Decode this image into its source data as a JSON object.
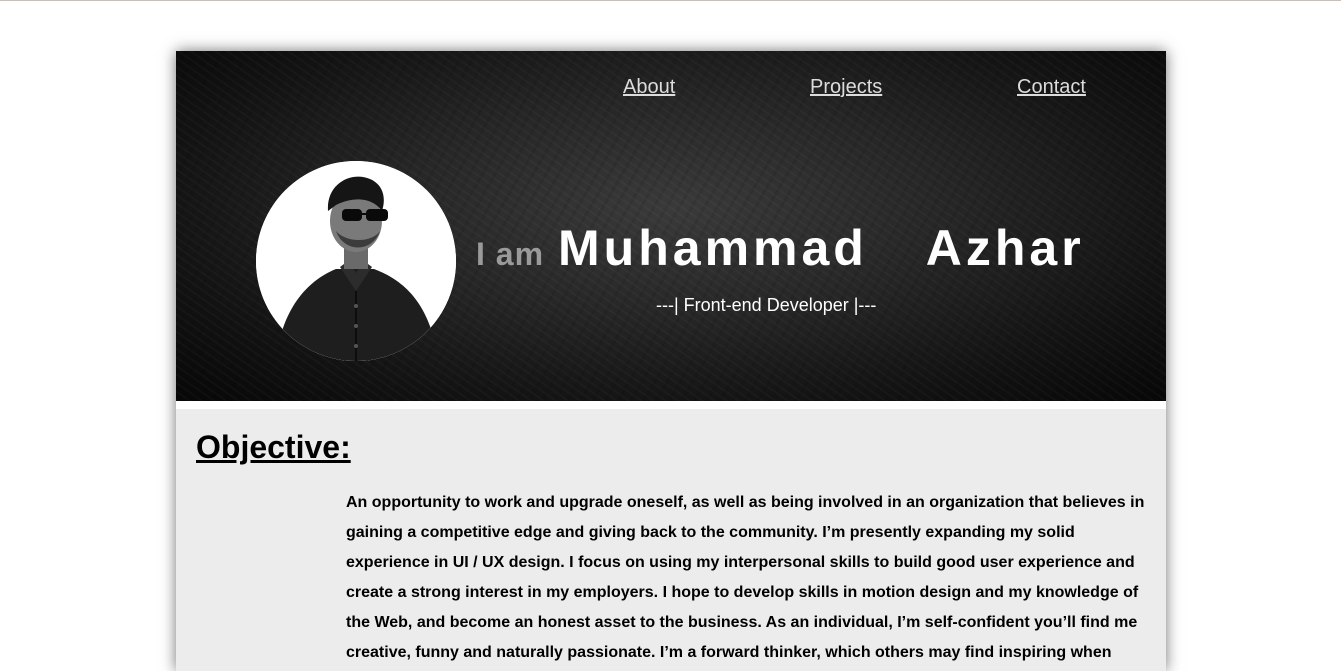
{
  "nav": {
    "about": "About",
    "projects": "Projects",
    "contact": "Contact"
  },
  "hero": {
    "intro_prefix": "I am",
    "name": "Muhammad  Azhar",
    "role": "---| Front-end Developer |---",
    "avatar_icon": "profile-photo"
  },
  "objective": {
    "title": "Objective:",
    "text": "An opportunity to work and upgrade oneself, as well as being involved in an organization that believes in gaining a competitive edge and giving back to the community. I’m presently expanding my solid experience in UI / UX design. I focus on using my interpersonal skills to build good user experience and create a strong interest in my employers. I hope to develop skills in motion design and my knowledge of the Web, and become an honest asset to the business. As an individual, I’m self-confident you’ll find me creative, funny and naturally passionate. I’m a forward thinker, which others may find inspiring when"
  },
  "colors": {
    "hero_bg": "#1a1a1a",
    "nav_text": "#dcdcdc",
    "intro_prefix": "#9a9a9a",
    "content_bg": "#ececec"
  }
}
